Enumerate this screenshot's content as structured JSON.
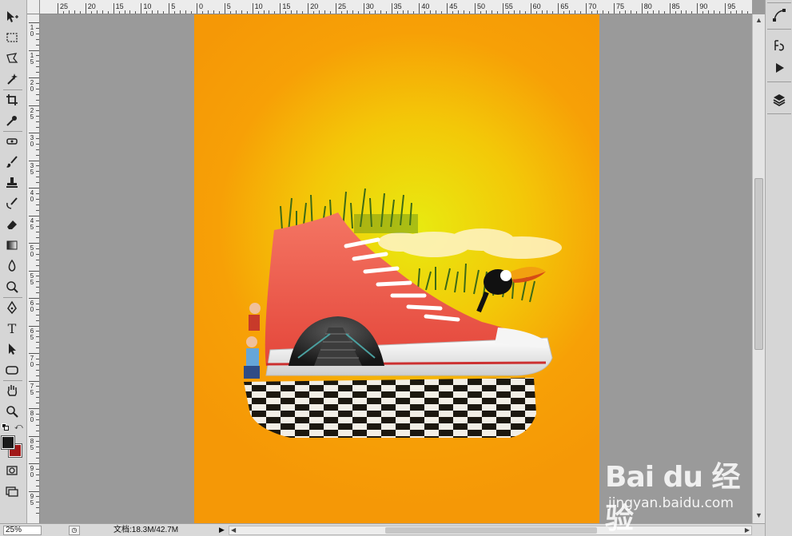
{
  "app": {
    "theme_color": "#d6d6d6",
    "canvas_bg": "#9a9a9a"
  },
  "toolbox": {
    "tools": [
      {
        "name": "move-tool-icon"
      },
      {
        "name": "marquee-tool-icon"
      },
      {
        "name": "lasso-tool-icon"
      },
      {
        "name": "magic-wand-tool-icon"
      },
      {
        "name": "crop-tool-icon"
      },
      {
        "name": "eyedropper-tool-icon"
      },
      {
        "name": "healing-brush-tool-icon"
      },
      {
        "name": "brush-tool-icon"
      },
      {
        "name": "clone-stamp-tool-icon"
      },
      {
        "name": "history-brush-tool-icon"
      },
      {
        "name": "eraser-tool-icon"
      },
      {
        "name": "gradient-tool-icon"
      },
      {
        "name": "blur-tool-icon"
      },
      {
        "name": "dodge-tool-icon"
      },
      {
        "name": "pen-tool-icon"
      },
      {
        "name": "type-tool-icon",
        "glyph": "T"
      },
      {
        "name": "path-selection-tool-icon"
      },
      {
        "name": "shape-tool-icon"
      },
      {
        "name": "hand-tool-icon"
      },
      {
        "name": "zoom-tool-icon"
      }
    ],
    "foreground_color": "#1a1a1a",
    "background_color": "#a11818"
  },
  "ruler_top": {
    "labels": [
      "25",
      "20",
      "15",
      "10",
      "5",
      "0",
      "5",
      "10",
      "15",
      "20",
      "25",
      "30",
      "35",
      "40",
      "45",
      "50",
      "55",
      "60",
      "65",
      "70",
      "75",
      "80",
      "85",
      "90",
      "95"
    ]
  },
  "ruler_left": {
    "labels": [
      [
        "1",
        "0"
      ],
      [
        "1",
        "5"
      ],
      [
        "2",
        "0"
      ],
      [
        "2",
        "5"
      ],
      [
        "3",
        "0"
      ],
      [
        "3",
        "5"
      ],
      [
        "4",
        "0"
      ],
      [
        "4",
        "5"
      ],
      [
        "5",
        "0"
      ],
      [
        "5",
        "5"
      ],
      [
        "6",
        "0"
      ],
      [
        "6",
        "5"
      ],
      [
        "7",
        "0"
      ],
      [
        "7",
        "5"
      ],
      [
        "8",
        "0"
      ],
      [
        "8",
        "5"
      ],
      [
        "9",
        "0"
      ],
      [
        "9",
        "5"
      ]
    ]
  },
  "dock": {
    "panels": [
      {
        "name": "paths-panel-icon"
      },
      {
        "name": "history-panel-icon"
      },
      {
        "name": "actions-panel-icon"
      },
      {
        "name": "layers-panel-icon"
      }
    ]
  },
  "status": {
    "zoom": "25%",
    "doc_info": "文档:18.3M/42.7M"
  },
  "watermark": {
    "logo": "Bai du 经验",
    "url": "jingyan.baidu.com"
  }
}
